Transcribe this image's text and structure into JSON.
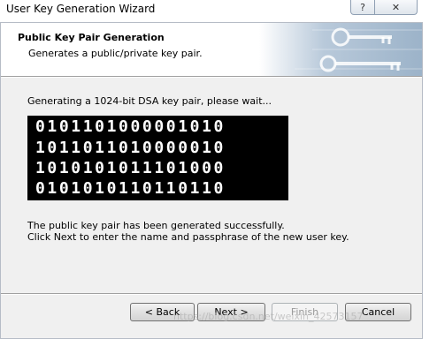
{
  "window": {
    "title": "User Key Generation Wizard",
    "help_glyph": "?",
    "close_glyph": "✕"
  },
  "header": {
    "title": "Public Key Pair Generation",
    "subtitle": "Generates a public/private key pair."
  },
  "content": {
    "generating_text": "Generating a 1024-bit DSA key pair, please wait...",
    "bit_rows": [
      "0101101000001010",
      "1011011010000010",
      "1010101011101000",
      "0101010110110110"
    ],
    "done_line1": "The public key pair has been generated successfully.",
    "done_line2": "Click Next to enter the name and passphrase of the new user key."
  },
  "buttons": {
    "back": "< Back",
    "next": "Next >",
    "finish": "Finish",
    "cancel": "Cancel"
  },
  "watermark": "https://blog.csdn.net/weixin_42573157"
}
